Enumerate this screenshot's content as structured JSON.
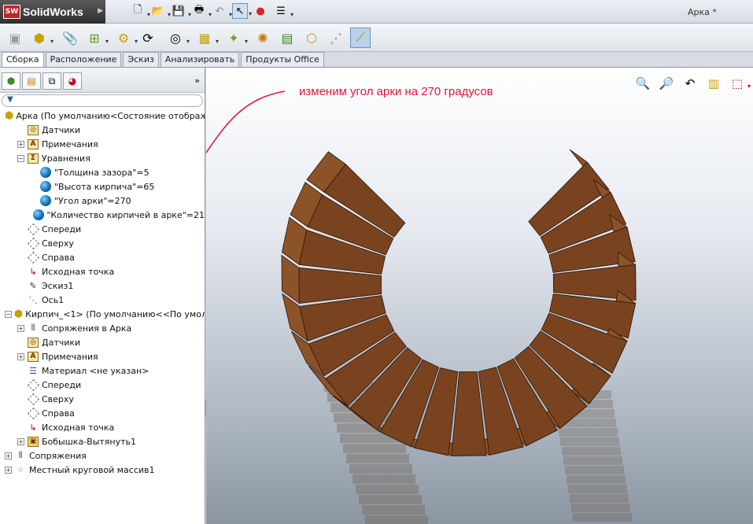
{
  "app": {
    "name": "SolidWorks",
    "logo_text": "SW",
    "document_title": "Арка *"
  },
  "tabs": [
    {
      "label": "Сборка",
      "active": true
    },
    {
      "label": "Расположение",
      "active": false
    },
    {
      "label": "Эскиз",
      "active": false
    },
    {
      "label": "Анализировать",
      "active": false
    },
    {
      "label": "Продукты Office",
      "active": false
    }
  ],
  "panel": {
    "more": "»",
    "filter_icon": "▼"
  },
  "tree": [
    {
      "level": 0,
      "icon": "assembly-icon",
      "label": "Арка  (По умолчанию<Состояние отображ"
    },
    {
      "level": 1,
      "icon": "sensor-icon",
      "label": "Датчики"
    },
    {
      "level": 1,
      "expand": "+",
      "icon": "annotation-icon",
      "label": "Примечания"
    },
    {
      "level": 1,
      "expand": "−",
      "icon": "equation-icon",
      "label": "Уравнения"
    },
    {
      "level": 2,
      "icon": "globe-icon",
      "label": "\"Толщина зазора\"=5"
    },
    {
      "level": 2,
      "icon": "globe-icon",
      "label": "\"Высота кирпича\"=65"
    },
    {
      "level": 2,
      "icon": "globe-icon",
      "label": "\"Угол арки\"=270"
    },
    {
      "level": 2,
      "icon": "globe-icon",
      "label": "\"Количество кирпичей в арке\"=21"
    },
    {
      "level": 1,
      "icon": "plane-icon",
      "label": "Спереди"
    },
    {
      "level": 1,
      "icon": "plane-icon",
      "label": "Сверху"
    },
    {
      "level": 1,
      "icon": "plane-icon",
      "label": "Справа"
    },
    {
      "level": 1,
      "icon": "origin-icon",
      "label": "Исходная точка"
    },
    {
      "level": 1,
      "icon": "sketch-icon",
      "label": "Эскиз1"
    },
    {
      "level": 1,
      "icon": "axis-icon",
      "label": "Ось1"
    },
    {
      "level": 0,
      "expand": "−",
      "icon": "part-icon",
      "label": "Кирпич_<1> (По умолчанию<<По умол"
    },
    {
      "level": 1,
      "expand": "+",
      "icon": "mates-icon",
      "label": "Сопряжения в Арка"
    },
    {
      "level": 1,
      "icon": "sensor-icon",
      "label": "Датчики"
    },
    {
      "level": 1,
      "expand": "+",
      "icon": "annotation-icon",
      "label": "Примечания"
    },
    {
      "level": 1,
      "icon": "material-icon",
      "label": "Материал <не указан>"
    },
    {
      "level": 1,
      "icon": "plane-icon",
      "label": "Спереди"
    },
    {
      "level": 1,
      "icon": "plane-icon",
      "label": "Сверху"
    },
    {
      "level": 1,
      "icon": "plane-icon",
      "label": "Справа"
    },
    {
      "level": 1,
      "icon": "origin-icon",
      "label": "Исходная точка"
    },
    {
      "level": 1,
      "expand": "+",
      "icon": "boss-extrude-icon",
      "label": "Бобышка-Вытянуть1"
    },
    {
      "level": 0,
      "expand": "+",
      "icon": "mates-icon",
      "label": "Сопряжения"
    },
    {
      "level": 0,
      "expand": "+",
      "icon": "pattern-icon",
      "label": "Местный круговой массив1"
    }
  ],
  "viewport": {
    "annotation": "изменим угол арки на 270 градусов",
    "annotation_color": "#e2173a",
    "brick_color": "#7a4320"
  }
}
